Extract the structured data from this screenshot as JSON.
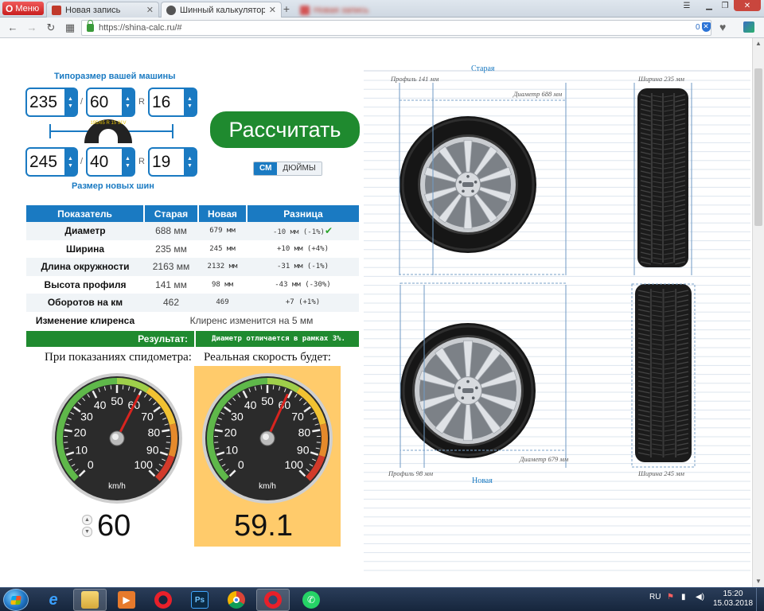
{
  "browser": {
    "menu_label": "Меню",
    "tabs": [
      {
        "title": "Новая запись",
        "favicon_color": "#c0392b",
        "active": false
      },
      {
        "title": "Шинный калькулятор он",
        "favicon_color": "#555555",
        "active": true
      },
      {
        "title": "Новая запись",
        "favicon_color": "#d35454",
        "active": false
      }
    ],
    "url": "https://shina-calc.ru/#",
    "blocked_count": "0"
  },
  "calculator": {
    "old_caption": "Типоразмер вашей машины",
    "new_caption": "Размер новых шин",
    "old_size": {
      "width": "235",
      "profile": "60",
      "rim": "16"
    },
    "new_size": {
      "width": "245",
      "profile": "40",
      "rim": "19"
    },
    "slash": "/",
    "r_letter": "R",
    "tire_icon_text": "195/65 R 15 91V",
    "calc_button": "Рассчитать",
    "units": [
      "СМ",
      "ДЮЙМЫ"
    ],
    "table": {
      "headers": [
        "Показатель",
        "Старая",
        "Новая",
        "Разница"
      ],
      "rows": [
        {
          "label": "Диаметр",
          "old": "688 мм",
          "new": "679 мм",
          "diff": "-10 мм (-1%)",
          "ok": true
        },
        {
          "label": "Ширина",
          "old": "235 мм",
          "new": "245 мм",
          "diff": "+10 мм (+4%)",
          "ok": false
        },
        {
          "label": "Длина окружности",
          "old": "2163 мм",
          "new": "2132 мм",
          "diff": "-31 мм (-1%)",
          "ok": false
        },
        {
          "label": "Высота профиля",
          "old": "141 мм",
          "new": "98 мм",
          "diff": "-43 мм (-30%)",
          "ok": false
        },
        {
          "label": "Оборотов на км",
          "old": "462",
          "new": "469",
          "diff": "+7 (+1%)",
          "ok": false
        }
      ],
      "clearance_label": "Изменение клиренса",
      "clearance_text": "Клиренс изменится на 5 мм",
      "result_label": "Результат:",
      "result_text": "Диаметр отличается в рамках 3%."
    },
    "speedometer": {
      "left_caption": "При показаниях спидометра:",
      "right_caption": "Реальная скорость будет:",
      "unit": "km/h",
      "ticks": [
        "0",
        "10",
        "20",
        "30",
        "40",
        "50",
        "60",
        "70",
        "80",
        "90",
        "100"
      ],
      "shown_speed": 60,
      "real_speed": 59.1,
      "shown_speed_text": "60",
      "real_speed_text": "59.1"
    }
  },
  "diagram": {
    "old_title": "Старая",
    "new_title": "Новая",
    "old_profile": "Профиль 141 мм",
    "old_width": "Ширина 235 мм",
    "old_diameter": "Диаметр 688 мм",
    "new_profile": "Профиль 98 мм",
    "new_width": "Ширина 245 мм",
    "new_diameter": "Диаметр 679 мм"
  },
  "taskbar": {
    "lang": "RU",
    "time": "15:20",
    "date": "15.03.2018",
    "apps": [
      "ie",
      "explorer",
      "media",
      "opera",
      "photoshop",
      "chrome",
      "opera",
      "whatsapp"
    ]
  },
  "colors": {
    "accent_blue": "#1a7ac2",
    "green": "#1f8a2f",
    "real_speed_bg": "#ffcb6b"
  }
}
